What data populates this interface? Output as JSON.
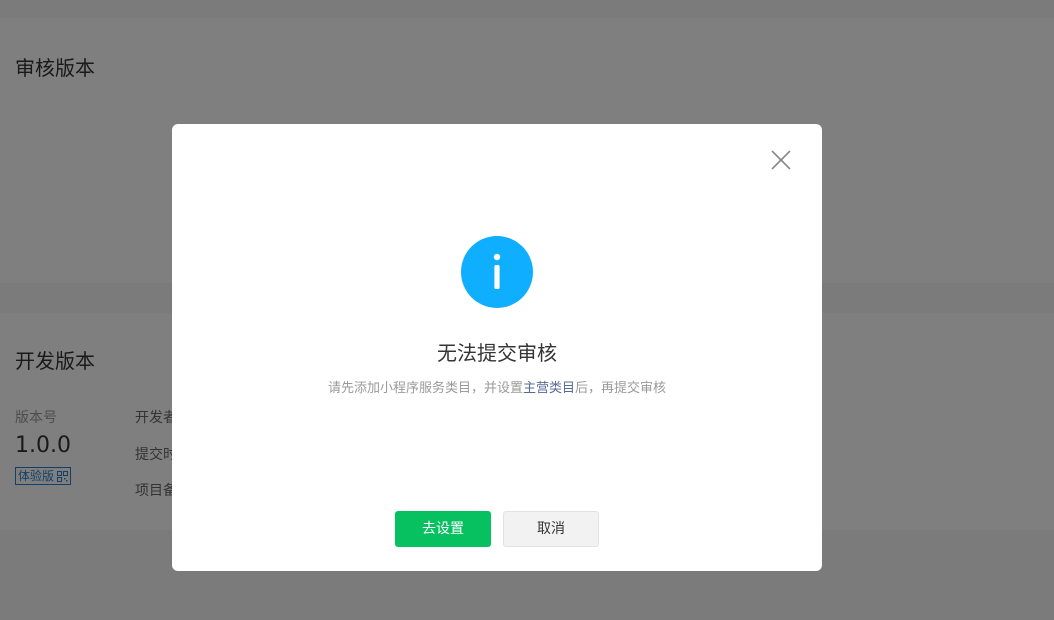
{
  "background": {
    "review_section": {
      "title": "审核版本"
    },
    "dev_section": {
      "title": "开发版本",
      "version_label": "版本号",
      "version_value": "1.0.0",
      "trial_tag": "体验版",
      "developer_label": "开发者",
      "submit_time_label": "提交时",
      "project_note_label": "项目备"
    }
  },
  "dialog": {
    "title": "无法提交审核",
    "description_before": "请先添加小程序服务类目，并设置",
    "description_link": "主营类目",
    "description_after": "后，再提交审核",
    "primary_button": "去设置",
    "cancel_button": "取消",
    "icon": "info-icon",
    "close_icon": "close-icon"
  },
  "colors": {
    "primary_green": "#07c160",
    "info_blue": "#10aeff",
    "link_blue": "#576b95",
    "mask": "rgba(0,0,0,0.5)"
  }
}
